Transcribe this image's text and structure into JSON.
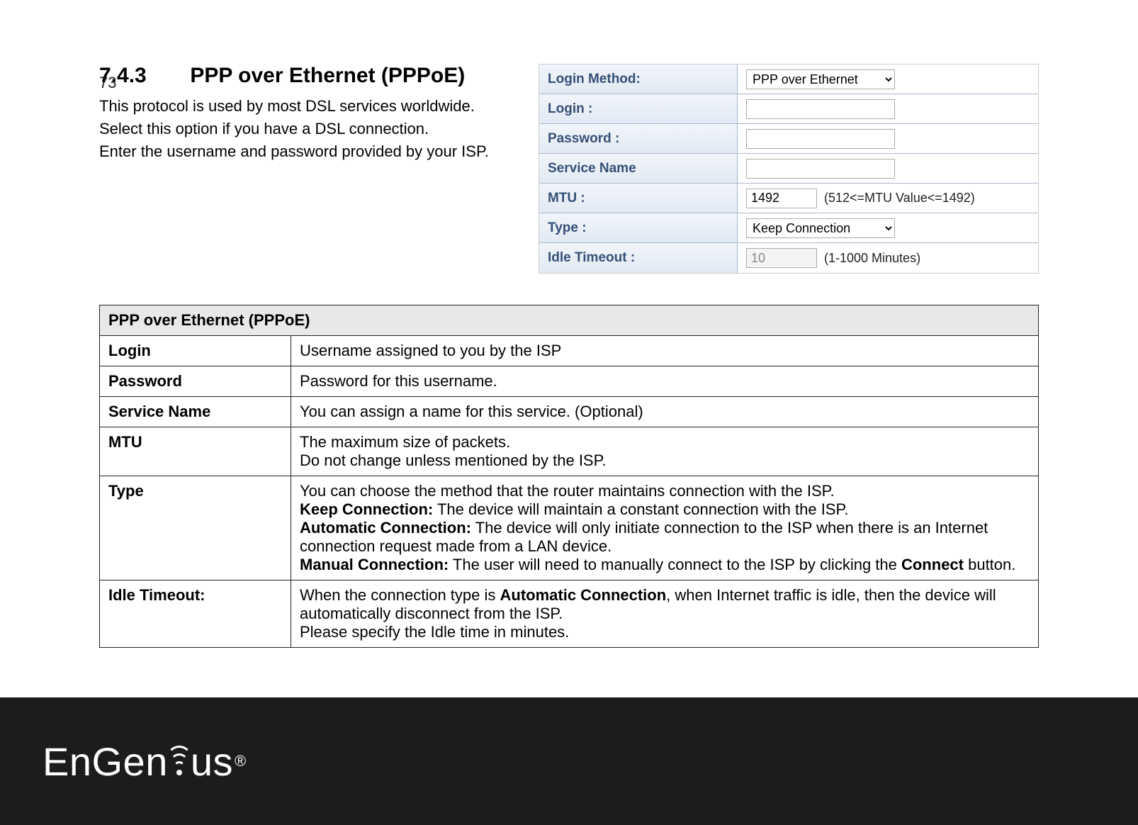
{
  "page_number": "73",
  "heading": {
    "number": "7.4.3",
    "title": "PPP over Ethernet (PPPoE)"
  },
  "intro": {
    "l1": "This protocol is used by most DSL services worldwide.",
    "l2": "Select this option if you have a DSL connection.",
    "l3": "Enter the username and password provided by your ISP."
  },
  "form": {
    "login_method": {
      "label": "Login Method:",
      "value": "PPP over Ethernet"
    },
    "login_opts": [
      "PPP over Ethernet"
    ],
    "login": {
      "label": "Login :",
      "value": ""
    },
    "password": {
      "label": "Password :",
      "value": ""
    },
    "service_name": {
      "label": "Service Name",
      "value": ""
    },
    "mtu": {
      "label": "MTU :",
      "value": "1492",
      "hint": "(512<=MTU Value<=1492)"
    },
    "type": {
      "label": "Type :",
      "value": "Keep Connection"
    },
    "type_opts": [
      "Keep Connection"
    ],
    "idle": {
      "label": "Idle Timeout :",
      "value": "10",
      "hint": "(1-1000 Minutes)"
    }
  },
  "table": {
    "header": "PPP over Ethernet (PPPoE)",
    "rows": {
      "login": {
        "term": "Login",
        "desc": "Username assigned to you by the ISP"
      },
      "password": {
        "term": "Password",
        "desc": "Password for this username."
      },
      "service": {
        "term": "Service Name",
        "desc": "You can assign a name for this service. (Optional)"
      },
      "mtu": {
        "term": "MTU",
        "l1": "The maximum size of packets.",
        "l2": "Do not change unless mentioned by the ISP."
      },
      "type": {
        "term": "Type",
        "l1": "You can choose the method that the router maintains connection with the ISP.",
        "kc_b": "Keep Connection:",
        "kc": " The device will maintain a constant connection with the ISP.",
        "ac_b": "Automatic Connection:",
        "ac": " The device will only initiate connection to the ISP when there is an Internet connection request made from a LAN device.",
        "mc_b": "Manual Connection:",
        "mc_a": " The user will need to manually connect to the ISP by clicking the ",
        "mc_bold": "Connect",
        "mc_c": " button."
      },
      "idle": {
        "term": "Idle Timeout:",
        "l1a": "When the connection type is ",
        "l1b": "Automatic Connection",
        "l1c": ", when Internet traffic is idle, then the device will automatically disconnect from the ISP.",
        "l2": "Please specify the Idle time in minutes."
      }
    }
  },
  "footer": {
    "brand_a": "EnGen",
    "brand_b": "us",
    "reg": "®"
  }
}
